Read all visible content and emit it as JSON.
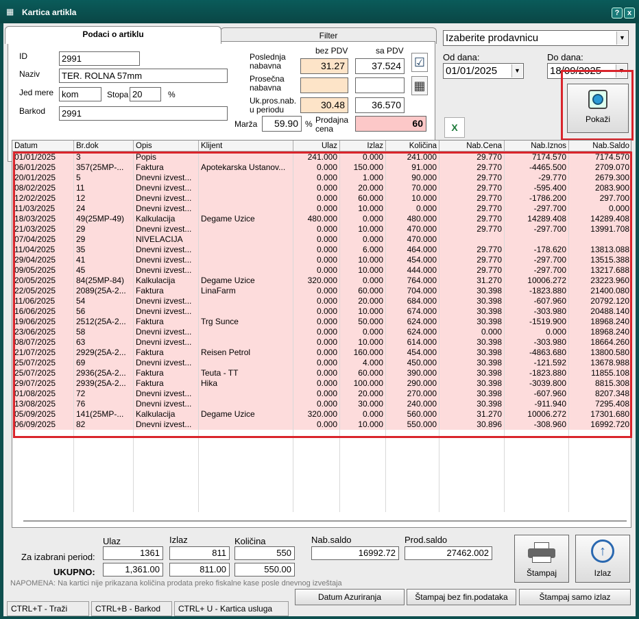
{
  "window": {
    "title": "Kartica artikla",
    "help": "?",
    "close": "x"
  },
  "tabs": {
    "item": "Podaci o artiklu",
    "filter": "Filter"
  },
  "article": {
    "id_label": "ID",
    "id": "2991",
    "name_label": "Naziv",
    "name": "TER. ROLNA 57mm",
    "unit_label": "Jed mere",
    "unit": "kom",
    "rate_label": "Stopa",
    "rate": "20",
    "percent": "%",
    "barcode_label": "Barkod",
    "barcode": "2991"
  },
  "prices": {
    "head_no_vat": "bez PDV",
    "head_vat": "sa PDV",
    "last_label_1": "Poslednja",
    "last_label_2": "nabavna",
    "last_no_vat": "31.27",
    "last_vat": "37.524",
    "avg_label_1": "Prosečna",
    "avg_label_2": "nabavna",
    "avg_no_vat": "",
    "avg_vat": "",
    "total_label_1": "Uk.pros.nab.",
    "total_label_2": "u periodu",
    "total_no_vat": "30.48",
    "total_vat": "36.570",
    "margin_label": "Marža",
    "margin": "59.90",
    "margin_pct": "%",
    "sell_label_1": "Prodajna",
    "sell_label_2": "cena",
    "sell": "60"
  },
  "filters": {
    "store": "Izaberite prodavnicu",
    "from_label": "Od dana:",
    "from": "01/01/2025",
    "to_label": "Do dana:",
    "to": "18/09/2025",
    "show_button": "Pokaži"
  },
  "columns": [
    "Datum",
    "Br.dok",
    "Opis",
    "Klijent",
    "Ulaz",
    "Izlaz",
    "Količina",
    "Nab.Cena",
    "Nab.Iznos",
    "Nab.Saldo"
  ],
  "rows": [
    [
      "01/01/2025",
      "3",
      "Popis",
      "",
      "241.000",
      "0.000",
      "241.000",
      "29.770",
      "7174.570",
      "7174.570"
    ],
    [
      "06/01/2025",
      "357(25MP-...",
      "Faktura",
      "Apotekarska Ustanov...",
      "0.000",
      "150.000",
      "91.000",
      "29.770",
      "-4465.500",
      "2709.070"
    ],
    [
      "20/01/2025",
      "5",
      "Dnevni izvest...",
      "",
      "0.000",
      "1.000",
      "90.000",
      "29.770",
      "-29.770",
      "2679.300"
    ],
    [
      "08/02/2025",
      "11",
      "Dnevni izvest...",
      "",
      "0.000",
      "20.000",
      "70.000",
      "29.770",
      "-595.400",
      "2083.900"
    ],
    [
      "12/02/2025",
      "12",
      "Dnevni izvest...",
      "",
      "0.000",
      "60.000",
      "10.000",
      "29.770",
      "-1786.200",
      "297.700"
    ],
    [
      "11/03/2025",
      "24",
      "Dnevni izvest...",
      "",
      "0.000",
      "10.000",
      "0.000",
      "29.770",
      "-297.700",
      "0.000"
    ],
    [
      "18/03/2025",
      "49(25MP-49)",
      "Kalkulacija",
      "Degame   Uzice",
      "480.000",
      "0.000",
      "480.000",
      "29.770",
      "14289.408",
      "14289.408"
    ],
    [
      "21/03/2025",
      "29",
      "Dnevni izvest...",
      "",
      "0.000",
      "10.000",
      "470.000",
      "29.770",
      "-297.700",
      "13991.708"
    ],
    [
      "07/04/2025",
      "29",
      "NIVELACIJA",
      "",
      "0.000",
      "0.000",
      "470.000",
      "",
      "",
      ""
    ],
    [
      "11/04/2025",
      "35",
      "Dnevni izvest...",
      "",
      "0.000",
      "6.000",
      "464.000",
      "29.770",
      "-178.620",
      "13813.088"
    ],
    [
      "29/04/2025",
      "41",
      "Dnevni izvest...",
      "",
      "0.000",
      "10.000",
      "454.000",
      "29.770",
      "-297.700",
      "13515.388"
    ],
    [
      "09/05/2025",
      "45",
      "Dnevni izvest...",
      "",
      "0.000",
      "10.000",
      "444.000",
      "29.770",
      "-297.700",
      "13217.688"
    ],
    [
      "20/05/2025",
      "84(25MP-84)",
      "Kalkulacija",
      "Degame   Uzice",
      "320.000",
      "0.000",
      "764.000",
      "31.270",
      "10006.272",
      "23223.960"
    ],
    [
      "22/05/2025",
      "2089(25A-2...",
      "Faktura",
      "LinaFarm",
      "0.000",
      "60.000",
      "704.000",
      "30.398",
      "-1823.880",
      "21400.080"
    ],
    [
      "11/06/2025",
      "54",
      "Dnevni izvest...",
      "",
      "0.000",
      "20.000",
      "684.000",
      "30.398",
      "-607.960",
      "20792.120"
    ],
    [
      "16/06/2025",
      "56",
      "Dnevni izvest...",
      "",
      "0.000",
      "10.000",
      "674.000",
      "30.398",
      "-303.980",
      "20488.140"
    ],
    [
      "19/06/2025",
      "2512(25A-2...",
      "Faktura",
      "Trg Sunce",
      "0.000",
      "50.000",
      "624.000",
      "30.398",
      "-1519.900",
      "18968.240"
    ],
    [
      "23/06/2025",
      "58",
      "Dnevni izvest...",
      "",
      "0.000",
      "0.000",
      "624.000",
      "0.000",
      "0.000",
      "18968.240"
    ],
    [
      "08/07/2025",
      "63",
      "Dnevni izvest...",
      "",
      "0.000",
      "10.000",
      "614.000",
      "30.398",
      "-303.980",
      "18664.260"
    ],
    [
      "21/07/2025",
      "2929(25A-2...",
      "Faktura",
      "Reisen Petrol",
      "0.000",
      "160.000",
      "454.000",
      "30.398",
      "-4863.680",
      "13800.580"
    ],
    [
      "25/07/2025",
      "69",
      "Dnevni izvest...",
      "",
      "0.000",
      "4.000",
      "450.000",
      "30.398",
      "-121.592",
      "13678.988"
    ],
    [
      "25/07/2025",
      "2936(25A-2...",
      "Faktura",
      "Teuta - TT",
      "0.000",
      "60.000",
      "390.000",
      "30.398",
      "-1823.880",
      "11855.108"
    ],
    [
      "29/07/2025",
      "2939(25A-2...",
      "Faktura",
      "Hika",
      "0.000",
      "100.000",
      "290.000",
      "30.398",
      "-3039.800",
      "8815.308"
    ],
    [
      "01/08/2025",
      "72",
      "Dnevni izvest...",
      "",
      "0.000",
      "20.000",
      "270.000",
      "30.398",
      "-607.960",
      "8207.348"
    ],
    [
      "13/08/2025",
      "76",
      "Dnevni izvest...",
      "",
      "0.000",
      "30.000",
      "240.000",
      "30.398",
      "-911.940",
      "7295.408"
    ],
    [
      "05/09/2025",
      "141(25MP-...",
      "Kalkulacija",
      "Degame   Uzice",
      "320.000",
      "0.000",
      "560.000",
      "31.270",
      "10006.272",
      "17301.680"
    ],
    [
      "06/09/2025",
      "82",
      "Dnevni izvest...",
      "",
      "0.000",
      "10.000",
      "550.000",
      "30.896",
      "-308.960",
      "16992.720"
    ]
  ],
  "summary": {
    "ulaz_label": "Ulaz",
    "izlaz_label": "Izlaz",
    "kolicina_label": "Količina",
    "nab_saldo_label": "Nab.saldo",
    "prod_saldo_label": "Prod.saldo",
    "period_label": "Za izabrani period:",
    "period_ulaz": "1361",
    "period_izlaz": "811",
    "period_kolicina": "550",
    "nab_saldo": "16992.72",
    "prod_saldo": "27462.002",
    "total_label": "UKUPNO:",
    "total_ulaz": "1,361.00",
    "total_izlaz": "811.00",
    "total_kolicina": "550.00",
    "note": "NAPOMENA: Na kartici nije prikazana količina prodata preko fiskalne kase posle dnevnog izveštaja"
  },
  "buttons": {
    "print": "Štampaj",
    "exit": "Izlaz",
    "date_update": "Datum Azuriranja",
    "print_no_fin": "Štampaj bez fin.podataka",
    "print_exit_only": "Štampaj samo izlaz"
  },
  "status": {
    "find": "CTRL+T - Traži",
    "barcode": "CTRL+B - Barkod",
    "services": "CTRL+ U - Kartica usluga"
  }
}
